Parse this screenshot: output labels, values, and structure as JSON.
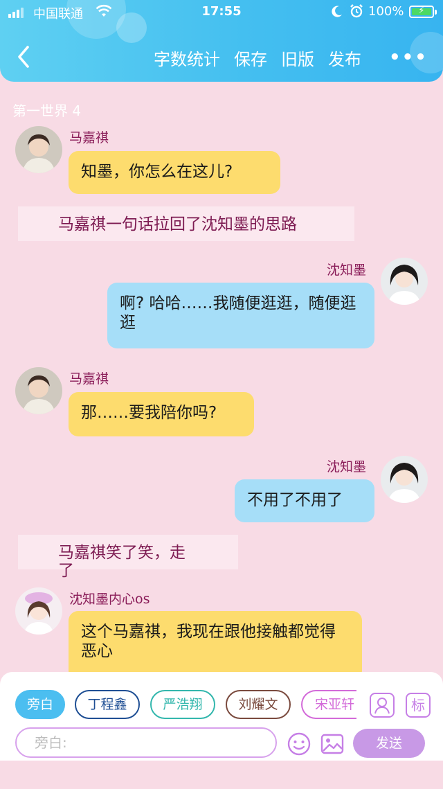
{
  "status_bar": {
    "carrier": "中国联通",
    "time": "17:55",
    "battery": "100%"
  },
  "header": {
    "actions": [
      "字数统计",
      "保存",
      "旧版",
      "发布"
    ],
    "more": "•••"
  },
  "chapter_title": "第一世界 4",
  "messages": [
    {
      "speaker": "马嘉祺",
      "text": "知墨，你怎么在这儿?"
    },
    {
      "narration": "马嘉祺一句话拉回了沈知墨的思路"
    },
    {
      "speaker": "沈知墨",
      "text": "啊? 哈哈……我随便逛逛，随便逛逛"
    },
    {
      "speaker": "马嘉祺",
      "text": "那……要我陪你吗?"
    },
    {
      "speaker": "沈知墨",
      "text": "不用了不用了"
    },
    {
      "narration": "马嘉祺笑了笑，走了"
    },
    {
      "speaker": "沈知墨内心os",
      "text": "这个马嘉祺，我现在跟他接触都觉得恶心"
    }
  ],
  "character_tabs": [
    {
      "label": "旁白",
      "color": "#3bb6f0",
      "active": true
    },
    {
      "label": "丁程鑫",
      "color": "#1f4f94",
      "active": false
    },
    {
      "label": "严浩翔",
      "color": "#33b7ad",
      "active": false
    },
    {
      "label": "刘耀文",
      "color": "#7a4a3e",
      "active": false
    },
    {
      "label": "宋亚轩",
      "color": "#d36bd9",
      "active": false
    }
  ],
  "tool_icons": {
    "character": "person-icon",
    "tag": "标"
  },
  "input": {
    "placeholder": "旁白:"
  },
  "send_label": "发送",
  "colors": {
    "header": "#44bff0",
    "background": "#f8dbe5",
    "left_bubble": "#fddc6e",
    "right_bubble": "#a6def8",
    "send": "#c899e6"
  }
}
